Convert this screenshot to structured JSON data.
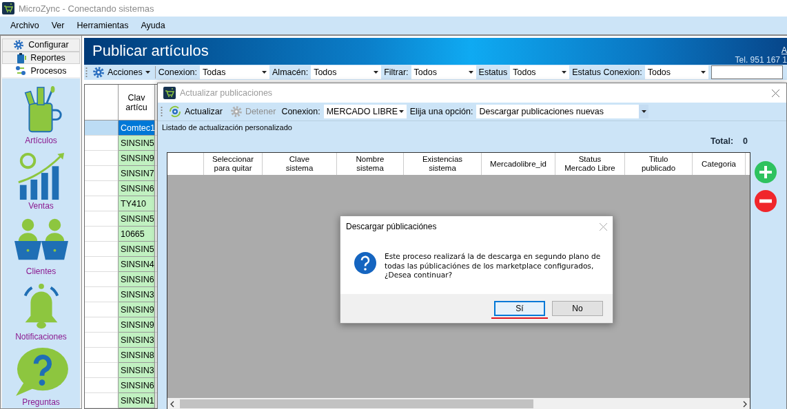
{
  "window": {
    "title": "MicroZync - Conectando sistemas"
  },
  "menu": [
    "Archivo",
    "Ver",
    "Herramientas",
    "Ayuda"
  ],
  "sidebar": {
    "tabs": [
      {
        "label": "Configurar",
        "selected": false
      },
      {
        "label": "Reportes",
        "selected": false
      },
      {
        "label": "Procesos",
        "selected": true
      }
    ],
    "items": [
      "Artículos",
      "Ventas",
      "Clientes",
      "Notificaciones",
      "Preguntas"
    ]
  },
  "page": {
    "title": "Publicar artículos",
    "link": "A",
    "phone": "Tel. 951 167 1"
  },
  "toolbar": {
    "actions": "Acciones",
    "filters": [
      {
        "label": "Conexion:",
        "value": "Todas"
      },
      {
        "label": "Almacén:",
        "value": "Todos"
      },
      {
        "label": "Filtrar:",
        "value": "Todos"
      },
      {
        "label": "Estatus",
        "value": "Todos"
      },
      {
        "label": "Estatus Conexion:",
        "value": "Todos"
      }
    ]
  },
  "grid": {
    "columns": [
      "Clav\nartícu"
    ],
    "rows": [
      {
        "cell": "Comtec1",
        "selected": true
      },
      {
        "cell": "SINSIN5",
        "selected": false
      },
      {
        "cell": "SINSIN9",
        "selected": false
      },
      {
        "cell": "SINSIN7",
        "selected": false
      },
      {
        "cell": "SINSIN6",
        "selected": false
      },
      {
        "cell": "TY410",
        "selected": false
      },
      {
        "cell": "SINSIN5",
        "selected": false
      },
      {
        "cell": "10665",
        "selected": false
      },
      {
        "cell": "SINSIN5",
        "selected": false
      },
      {
        "cell": "SINSIN4",
        "selected": false
      },
      {
        "cell": "SINSIN6",
        "selected": false
      },
      {
        "cell": "SINSIN3",
        "selected": false
      },
      {
        "cell": "SINSIN9",
        "selected": false
      },
      {
        "cell": "SINSIN9",
        "selected": false
      },
      {
        "cell": "SINSIN3",
        "selected": false
      },
      {
        "cell": "SINSIN8",
        "selected": false
      },
      {
        "cell": "SINSIN3",
        "selected": false
      },
      {
        "cell": "SINSIN6",
        "selected": false
      },
      {
        "cell": "SINSIN1",
        "selected": false
      }
    ]
  },
  "dialog": {
    "title": "Actualizar publicaciones",
    "tools": [
      {
        "label": "Actualizar",
        "disabled": false
      },
      {
        "label": "Detener",
        "disabled": true
      }
    ],
    "connection": {
      "label": "Conexion:",
      "value": "MERCADO LIBRE"
    },
    "option": {
      "label": "Elija una opción:",
      "value": "Descargar publicaciones nuevas"
    },
    "group_label": "Listado de actualización personalizado",
    "total_label": "Total:",
    "total": "0",
    "columns": [
      "Seleccionar\npara quitar",
      "Clave\nsistema",
      "Nombre\nsistema",
      "Existencias\nsistema",
      "Mercadolibre_id",
      "Status\nMercado Libre",
      "Titulo\npublicado",
      "Categoria"
    ]
  },
  "message": {
    "title": "Descargar públicaciónes",
    "text": "Este proceso realizará la de descarga en segundo plano de\ntodas las públicaciónes de los marketplace configurados,\n¿Desea continuar?",
    "buttons": [
      {
        "label": "Sí",
        "focused": true,
        "underlined": true
      },
      {
        "label": "No",
        "focused": false,
        "underlined": false
      }
    ]
  }
}
